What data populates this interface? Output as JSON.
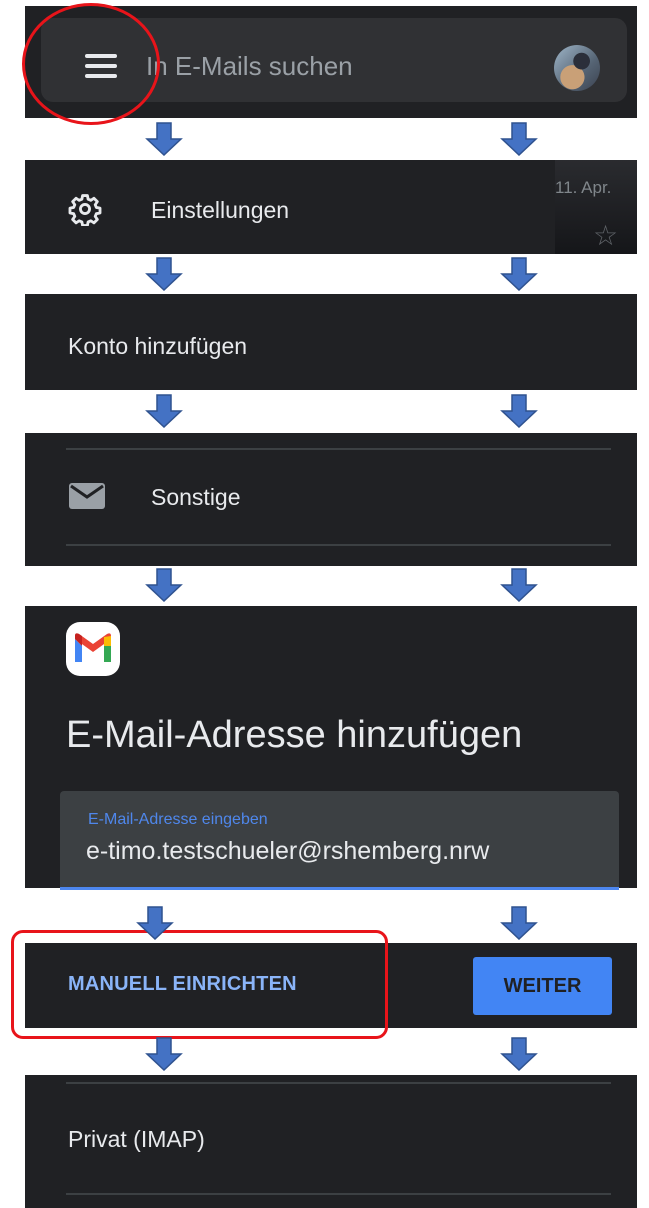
{
  "search": {
    "placeholder": "In E-Mails suchen"
  },
  "settings": {
    "label": "Einstellungen",
    "partial_date": "11. Apr."
  },
  "add_account": {
    "label": "Konto hinzufügen"
  },
  "other": {
    "label": "Sonstige"
  },
  "email_form": {
    "heading": "E-Mail-Adresse hinzufügen",
    "field_label": "E-Mail-Adresse eingeben",
    "field_value": "e-timo.testschueler@rshemberg.nrw"
  },
  "actions": {
    "manual_label": "MANUELL EINRICHTEN",
    "next_label": "WEITER"
  },
  "account_type": {
    "label": "Privat (IMAP)"
  },
  "colors": {
    "panel_bg": "#202124",
    "accent_blue": "#4285f4",
    "link_blue": "#8ab4f8",
    "highlight_red": "#e8141a",
    "arrow_blue": "#4472c4"
  },
  "icons": [
    "menu-icon",
    "avatar",
    "gear-icon",
    "star-icon",
    "mail-icon",
    "gmail-logo",
    "arrow-down-icon"
  ]
}
